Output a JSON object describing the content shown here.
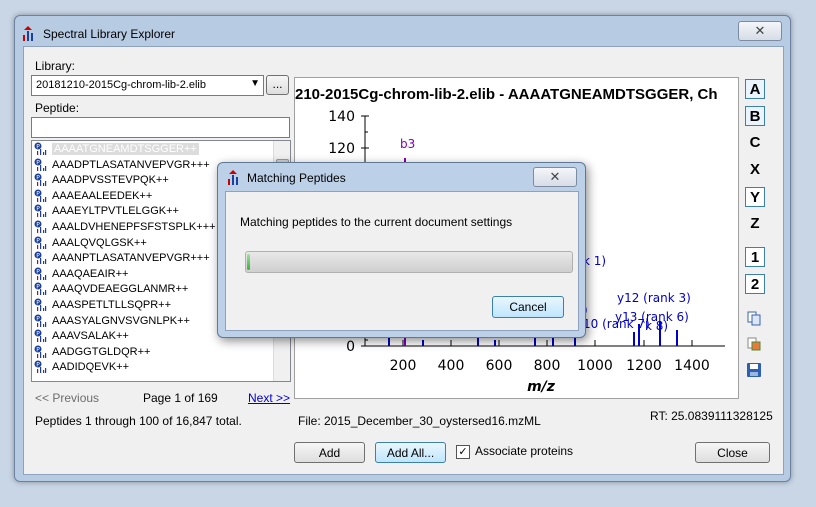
{
  "window": {
    "title": "Spectral Library Explorer",
    "close": "✕"
  },
  "library": {
    "label": "Library:",
    "selected": "20181210-2015Cg-chrom-lib-2.elib",
    "browse": "..."
  },
  "peptide": {
    "label": "Peptide:",
    "filter_value": ""
  },
  "peptides": [
    "AAAATGNEAMDTSGGER++",
    "AAADPTLASATANVEPVGR+++",
    "AAADPVSSTEVPQK++",
    "AAAEAALEEDEK++",
    "AAAEYLTPVTLELGGK++",
    "AAALDVHENEPFSFSTSPLK+++",
    "AAALQVQLGSK++",
    "AAANPTLASATANVEPVGR+++",
    "AAAQAEAIR++",
    "AAAQVDEAEGGLANMR++",
    "AAASPETLTLLSQPR++",
    "AAASYALGNVSVGNLPK++",
    "AAAVSALAK++",
    "AADGGTGLDQR++",
    "AADIDQEVK++"
  ],
  "paging": {
    "prev": "<< Previous",
    "page_text": "Page 1 of 169",
    "next": "Next >>",
    "summary": "Peptides 1 through 100 of 16,847 total."
  },
  "graph": {
    "title": "210-2015Cg-chrom-lib-2.elib - AAAATGNEAMDTSGGER, Ch",
    "xlabel": "m/z",
    "yticks": [
      "140",
      "120",
      "0"
    ],
    "xticks": [
      "200",
      "400",
      "600",
      "800",
      "1000",
      "1200",
      "1400"
    ],
    "annotations": [
      "b3",
      "k 1)",
      "y12 (rank 3)",
      "y13 (rank 6)",
      "10 (rank 7)",
      "k 8)",
      ")"
    ]
  },
  "ion_buttons": [
    "A",
    "B",
    "C",
    "X",
    "Y",
    "Z",
    "1",
    "2"
  ],
  "file_info": "File: 2015_December_30_oystersed16.mzML",
  "rt_info": "RT: 25.0839111328125",
  "buttons": {
    "add": "Add",
    "add_all": "Add All...",
    "close": "Close"
  },
  "associate": {
    "label": "Associate proteins",
    "checked": true
  },
  "dialog": {
    "title": "Matching Peptides",
    "message": "Matching peptides to the current document settings",
    "cancel": "Cancel",
    "close": "✕",
    "progress": 0.01
  },
  "colors": {
    "blue_ion": "#0000cc",
    "purple_ion": "#7f00bf",
    "accent": "#3c7fb1"
  }
}
